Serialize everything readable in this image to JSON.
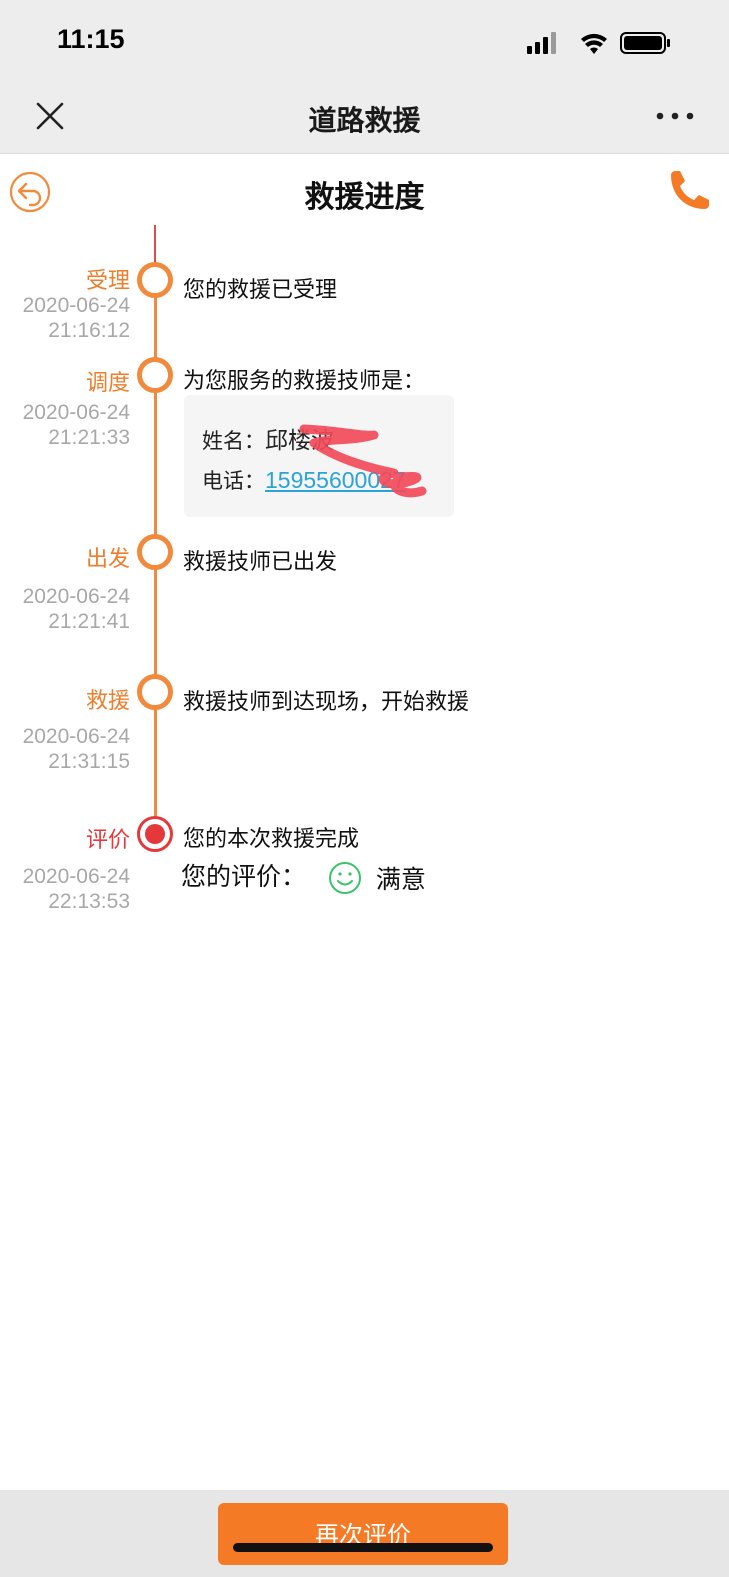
{
  "status_bar": {
    "time": "11:15"
  },
  "nav": {
    "title": "道路救援"
  },
  "header": {
    "title": "救援进度"
  },
  "steps": [
    {
      "label": "受理",
      "date": "2020-06-24",
      "time": "21:16:12",
      "text": "您的救援已受理"
    },
    {
      "label": "调度",
      "date": "2020-06-24",
      "time": "21:21:33",
      "text": "为您服务的救援技师是："
    },
    {
      "label": "出发",
      "date": "2020-06-24",
      "time": "21:21:41",
      "text": "救援技师已出发"
    },
    {
      "label": "救援",
      "date": "2020-06-24",
      "time": "21:31:15",
      "text": "救援技师到达现场，开始救援"
    },
    {
      "label": "评价",
      "date": "2020-06-24",
      "time": "22:13:53",
      "text": "您的本次救援完成"
    }
  ],
  "technician": {
    "name_label": "姓名：",
    "name_value": "邱楼波",
    "phone_label": "电话：",
    "phone_value": "15955600027"
  },
  "rating": {
    "label": "您的评价：",
    "value": "满意"
  },
  "bottom": {
    "button_label": "再次评价"
  },
  "colors": {
    "accent": "#f18a3c",
    "final": "#e5383b",
    "link": "#2aa3d6",
    "button": "#f47a25"
  }
}
